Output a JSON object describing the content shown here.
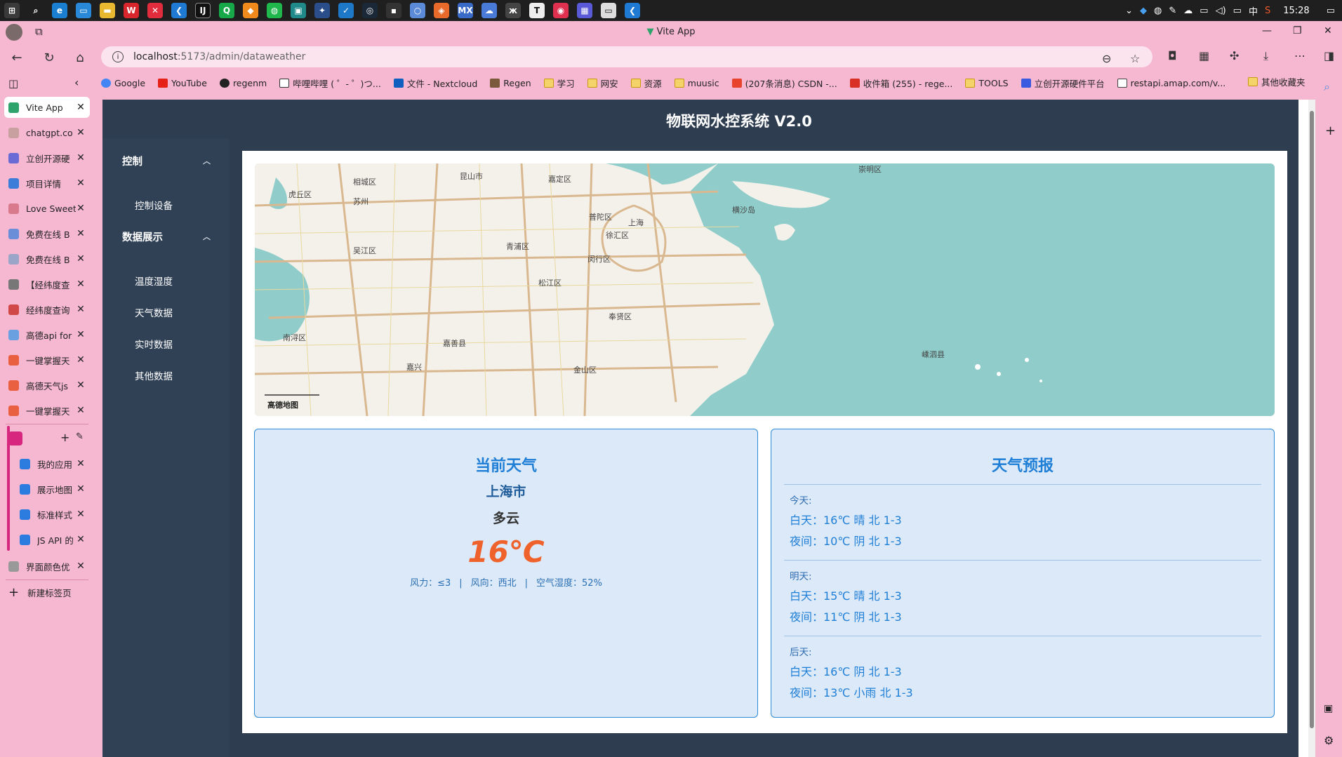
{
  "taskbar": {
    "time": "15:28",
    "ime": "中"
  },
  "browser": {
    "window_title": "Vite App",
    "url_host": "localhost",
    "url_path": ":5173/admin/dataweather",
    "bookmarks": [
      "Google",
      "YouTube",
      "regenm",
      "哔哩哔哩 ( ゜- ゜)つ...",
      "文件 - Nextcloud",
      "Regen",
      "学习",
      "网安",
      "资源",
      "muusic",
      "(207条消息) CSDN -...",
      "收件箱 (255) - rege...",
      "TOOLS",
      "立创开源硬件平台",
      "restapi.amap.com/v..."
    ],
    "bookmarks_other": "其他收藏夹",
    "tabs": [
      {
        "label": "Vite App",
        "color": "#2ea36b"
      },
      {
        "label": "chatgpt.co",
        "color": "#c9a0a0"
      },
      {
        "label": "立创开源硬",
        "color": "#6b6bd6"
      },
      {
        "label": "项目详情",
        "color": "#3b7dd8"
      },
      {
        "label": "Love Sweet",
        "color": "#d87a8c"
      },
      {
        "label": "免费在线 B",
        "color": "#6a8fd8"
      },
      {
        "label": "免费在线 B",
        "color": "#9aa5c8"
      },
      {
        "label": "【经纬度查",
        "color": "#777"
      },
      {
        "label": "经纬度查询",
        "color": "#d04848"
      },
      {
        "label": "高德api for",
        "color": "#6aa0e0"
      },
      {
        "label": "一键掌握天",
        "color": "#e86040"
      },
      {
        "label": "高德天气js",
        "color": "#e86040"
      },
      {
        "label": "一键掌握天",
        "color": "#e86040"
      }
    ],
    "group_tabs": [
      {
        "label": "我的应用",
        "color": "#2c7ce0"
      },
      {
        "label": "展示地图",
        "color": "#2c7ce0"
      },
      {
        "label": "标准样式",
        "color": "#2c7ce0"
      },
      {
        "label": "JS API 的",
        "color": "#2c7ce0"
      }
    ],
    "last_tab": {
      "label": "界面颜色优",
      "color": "#999"
    },
    "new_tab_label": "新建标签页"
  },
  "app": {
    "title": "物联网水控系统 V2.0",
    "menu": {
      "group_control": "控制",
      "item_control_device": "控制设备",
      "group_data": "数据展示",
      "items": [
        "温度湿度",
        "天气数据",
        "实时数据",
        "其他数据"
      ]
    },
    "map": {
      "labels": [
        "虎丘区",
        "相城区",
        "苏州",
        "昆山市",
        "嘉定区",
        "吴江区",
        "青浦区",
        "普陀区",
        "上海",
        "徐汇区",
        "闵行区",
        "松江区",
        "南浔区",
        "嘉善县",
        "奉贤区",
        "嘉兴",
        "金山区",
        "崇明区",
        "横沙岛",
        "嵊泗县"
      ],
      "logo": "高德地图"
    },
    "current": {
      "title": "当前天气",
      "city": "上海市",
      "condition": "多云",
      "temperature": "16℃",
      "wind_power": "风力：≤3",
      "wind_direction": "风向：西北",
      "humidity": "空气湿度：52%"
    },
    "forecast": {
      "title": "天气预报",
      "days": [
        {
          "label": "今天:",
          "day": "白天：16℃ 晴 北 1-3",
          "night": "夜间：10℃ 阴 北 1-3"
        },
        {
          "label": "明天:",
          "day": "白天：15℃ 晴 北 1-3",
          "night": "夜间：11℃ 阴 北 1-3"
        },
        {
          "label": "后天:",
          "day": "白天：16℃ 阴 北 1-3",
          "night": "夜间：13℃ 小雨 北 1-3"
        }
      ]
    }
  }
}
